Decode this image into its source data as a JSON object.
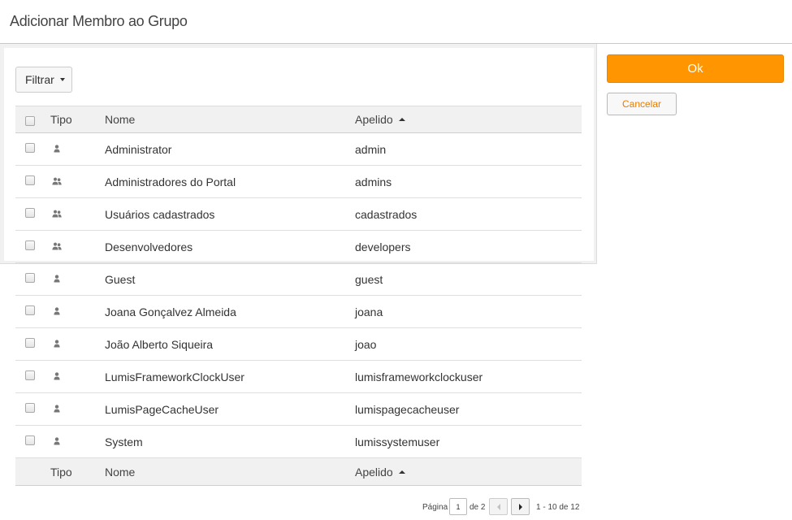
{
  "header": {
    "title": "Adicionar Membro ao Grupo"
  },
  "toolbar": {
    "filter_label": "Filtrar"
  },
  "table": {
    "columns": {
      "type": "Tipo",
      "name": "Nome",
      "alias": "Apelido"
    },
    "sort": {
      "column": "alias",
      "direction": "ascending"
    },
    "rows": [
      {
        "type": "user-icon",
        "name": "Administrator",
        "alias": "admin"
      },
      {
        "type": "group-icon",
        "name": "Administradores do Portal",
        "alias": "admins"
      },
      {
        "type": "group-icon",
        "name": "Usuários cadastrados",
        "alias": "cadastrados"
      },
      {
        "type": "group-icon",
        "name": "Desenvolvedores",
        "alias": "developers"
      },
      {
        "type": "user-icon",
        "name": "Guest",
        "alias": "guest"
      },
      {
        "type": "user-icon",
        "name": "Joana Gonçalvez Almeida",
        "alias": "joana"
      },
      {
        "type": "user-icon",
        "name": "João Alberto Siqueira",
        "alias": "joao"
      },
      {
        "type": "user-icon",
        "name": "LumisFrameworkClockUser",
        "alias": "lumisframeworkclockuser"
      },
      {
        "type": "user-icon",
        "name": "LumisPageCacheUser",
        "alias": "lumispagecacheuser"
      },
      {
        "type": "user-icon",
        "name": "System",
        "alias": "lumissystemuser"
      }
    ]
  },
  "actions": {
    "ok_label": "Ok",
    "cancel_label": "Cancelar"
  },
  "pager": {
    "page_label": "Página",
    "current_page": "1",
    "of_label": "de 2",
    "range_label": "1 - 10 de 12"
  },
  "colors": {
    "accent": "#ff9501",
    "cancel_text": "#e77d00",
    "header_bg": "#f1f1f1"
  }
}
